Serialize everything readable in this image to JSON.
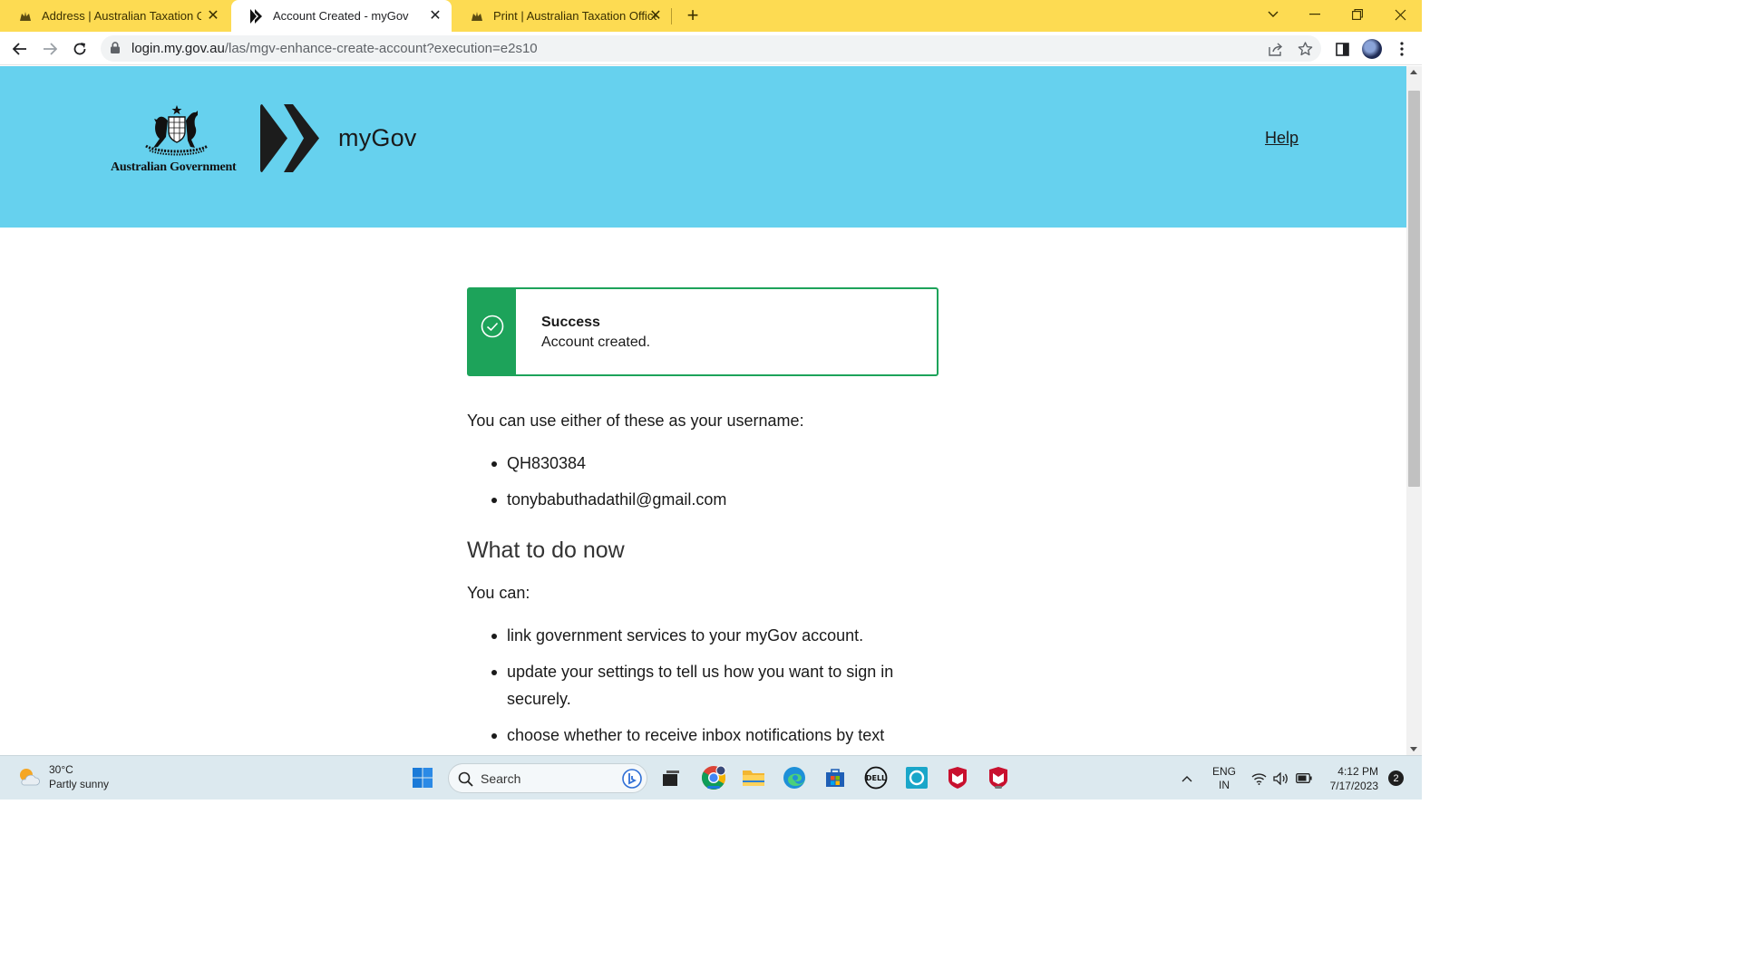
{
  "browser": {
    "tabs": [
      {
        "title": "Address | Australian Taxation Office",
        "active": false
      },
      {
        "title": "Account Created - myGov",
        "active": true
      },
      {
        "title": "Print | Australian Taxation Office",
        "active": false
      }
    ],
    "url_host": "login.my.gov.au",
    "url_path": "/las/mgv-enhance-create-account?execution=e2s10"
  },
  "header": {
    "gov_name": "Australian Government",
    "brand": "myGov",
    "help_label": "Help",
    "background": "#66d1ee"
  },
  "alert": {
    "title": "Success",
    "message": "Account created.",
    "color": "#1da35a"
  },
  "main": {
    "username_intro": "You can use either of these as your username:",
    "usernames": [
      "QH830384",
      "tonybabuthadathil@gmail.com"
    ],
    "heading": "What to do now",
    "can_intro": "You can:",
    "actions": [
      "link government services to your myGov account.",
      "update your settings to tell us how you want to sign in securely.",
      "choose whether to receive inbox notifications by text"
    ]
  },
  "taskbar": {
    "weather_temp": "30°C",
    "weather_desc": "Partly sunny",
    "search_label": "Search",
    "lang_line1": "ENG",
    "lang_line2": "IN",
    "time": "4:12 PM",
    "date": "7/17/2023",
    "notification_count": "2"
  }
}
